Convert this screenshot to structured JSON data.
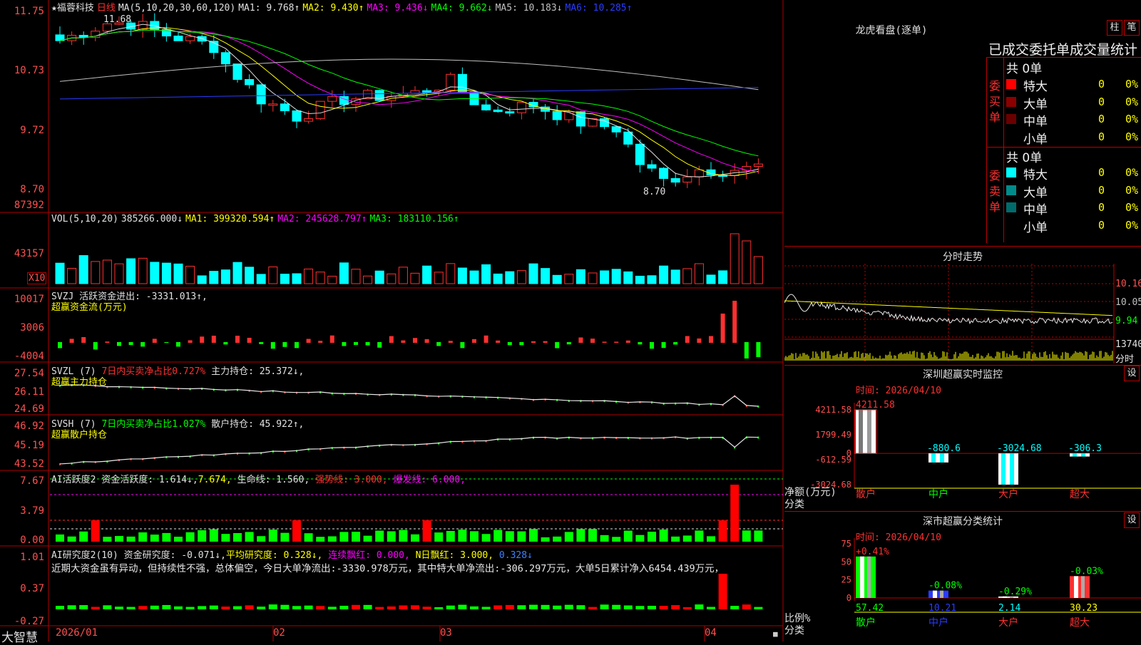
{
  "chart_header": {
    "star_name": "★福蓉科技",
    "period": "日线",
    "ma_prefix": "MA(5,10,20,30,60,120)",
    "ma1": "MA1: 9.768↑",
    "ma2": "MA2: 9.430↑",
    "ma3": "MA3: 9.436↓",
    "ma4": "MA4: 9.662↓",
    "ma5": "MA5: 10.183↓",
    "ma6": "MA6: 10.285↑"
  },
  "price_axis": [
    "11.75",
    "10.73",
    "9.72",
    "8.70"
  ],
  "price_annotations": {
    "high": "11.68",
    "low": "8.70"
  },
  "vol_header": {
    "prefix": "VOL(5,10,20)",
    "val": "385266.000↓",
    "ma1": "MA1: 399320.594↑",
    "ma2": "MA2: 245628.797↑",
    "ma3": "MA3: 183110.156↑"
  },
  "vol_axis": [
    "87392",
    "43157",
    "X10"
  ],
  "svzj": {
    "prefix": "SVZJ",
    "text": "活跃资金进出: -3331.013↑,",
    "sub": "超赢资金流(万元)",
    "axis": [
      "10017",
      "3006",
      "-4004"
    ]
  },
  "svzl": {
    "prefix": "SVZL (7)",
    "text1": "7日内买卖净占比0.727%",
    "text2": "主力持仓: 25.372↓,",
    "sub": "超赢主力持仓",
    "axis": [
      "27.54",
      "26.11",
      "24.69"
    ]
  },
  "svsh": {
    "prefix": "SVSH (7)",
    "text1": "7日内买卖净占比1.027%",
    "text2": "散户持仓: 45.922↑,",
    "sub": "超赢散户持仓",
    "axis": [
      "46.92",
      "45.19",
      "43.52"
    ]
  },
  "ai_active": {
    "prefix": "AI活跃度2",
    "t1": "资金活跃度: 1.614↓,",
    "t2": "7.674,",
    "t3": "生命线: 1.560,",
    "t4": "强势线: 3.000,",
    "t5": "爆发线: 6.000,",
    "axis": [
      "7.67",
      "3.79",
      "0.00"
    ]
  },
  "ai_research": {
    "prefix": "AI研究度2(10)",
    "t1": "资金研究度: -0.071↓,",
    "t2": "平均研究度: 0.328↓,",
    "t3": "连续飘红: 0.000,",
    "t4": "N日飘红: 3.000,",
    "t5": "0.328↓",
    "comment": "近期大资金虽有异动，但持续性不强，总体偏空，今日大单净流出:-3330.978万元，其中特大单净流出:-306.297万元，大单5日累计净入6454.439万元，",
    "axis": [
      "1.01",
      "0.37",
      "-0.27"
    ]
  },
  "date_axis": [
    "2026/01",
    "02",
    "03",
    "04"
  ],
  "brand": "大智慧",
  "dragon": {
    "title": "龙虎看盘(逐单)",
    "btn1": "柱",
    "btn2": "笔",
    "subtitle": "已成交委托单成交量统计",
    "buy_label": "委买单",
    "sell_label": "委卖单",
    "buy_total": "共 0单",
    "sell_total": "共 0单",
    "rows": [
      {
        "name": "特大",
        "count": "0",
        "pct": "0%"
      },
      {
        "name": "大单",
        "count": "0",
        "pct": "0%"
      },
      {
        "name": "中单",
        "count": "0",
        "pct": "0%"
      },
      {
        "name": "小单",
        "count": "0",
        "pct": "0%"
      }
    ],
    "buy_colors": [
      "#ff0000",
      "#8b0000",
      "#6b0000",
      "#000000"
    ],
    "sell_colors": [
      "#00ffff",
      "#008b8b",
      "#006b6b",
      "#000000"
    ]
  },
  "intraday": {
    "title": "分时走势",
    "axis": [
      "10.16",
      "10.05",
      "9.94",
      "13740",
      "分时"
    ]
  },
  "realtime": {
    "title": "深圳超赢实时监控",
    "btn": "设",
    "time": "时间: 2026/04/10",
    "axis": [
      "4211.58",
      "1799.49",
      "0",
      "-612.59",
      "-3024.68"
    ],
    "ylabel": "净额(万元)",
    "xlabel": "分类",
    "chart_data": {
      "type": "bar",
      "categories": [
        "散户",
        "中户",
        "大户",
        "超大"
      ],
      "values": [
        4211.58,
        -880.6,
        -3024.68,
        -306.3
      ],
      "labels": [
        "4211.58",
        "-880.6",
        "-3024.68",
        "-306.3"
      ],
      "ylim": [
        -3024.68,
        4211.58
      ]
    }
  },
  "classify": {
    "title": "深市超赢分类统计",
    "btn": "设",
    "time": "时间: 2026/04/10",
    "axis": [
      "75",
      "50",
      "25",
      "0"
    ],
    "ylabel": "比例%",
    "xlabel": "分类",
    "chart_data": {
      "type": "bar",
      "categories": [
        "散户",
        "中户",
        "大户",
        "超大"
      ],
      "values": [
        57.42,
        10.21,
        2.14,
        30.23
      ],
      "changes": [
        "+0.41%",
        "-0.08%",
        "-0.29%",
        "-0.03%"
      ],
      "value_labels": [
        "57.42",
        "10.21",
        "2.14",
        "30.23"
      ],
      "ylim": [
        0,
        75
      ]
    }
  }
}
